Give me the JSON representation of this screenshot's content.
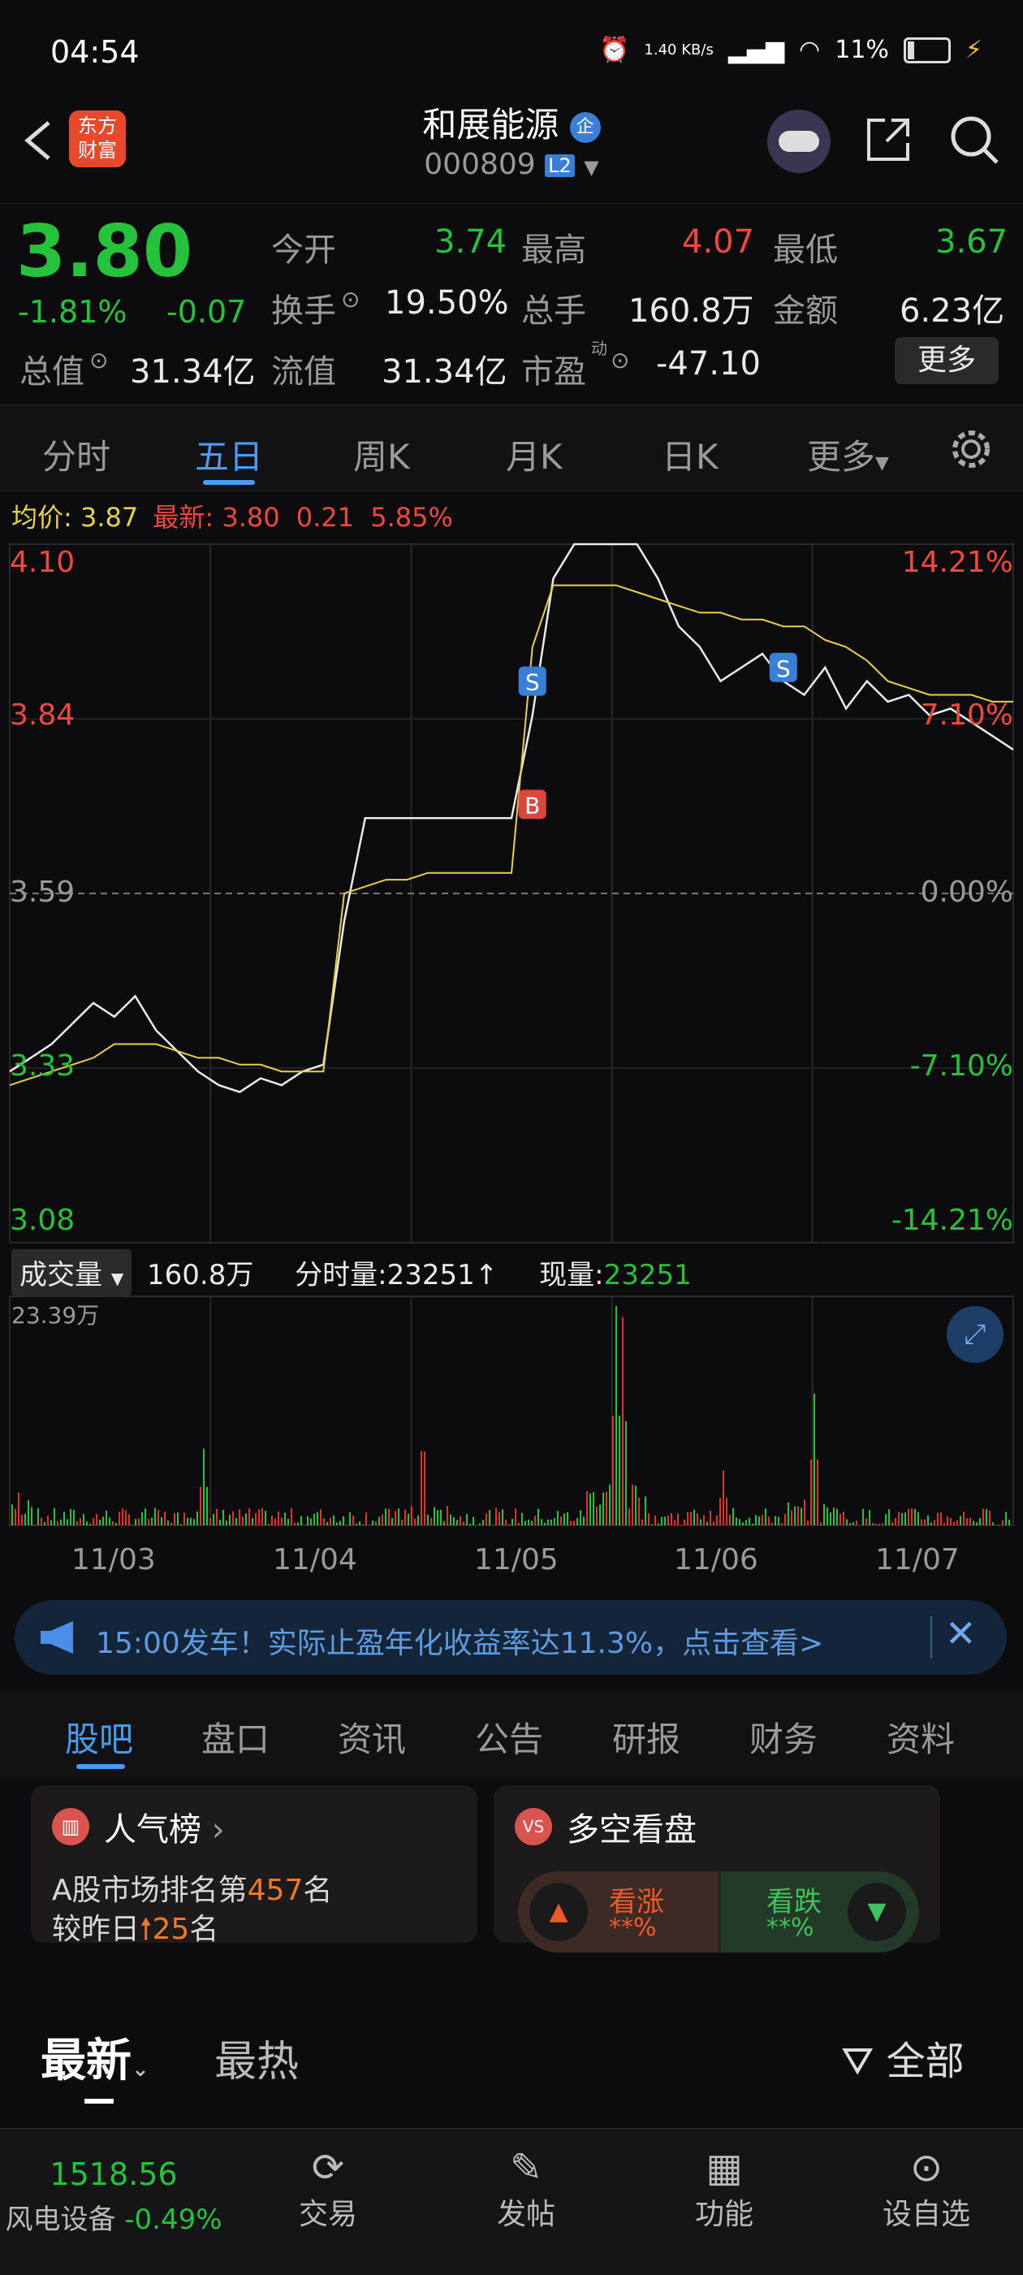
{
  "status_bar": {
    "time": "04:54",
    "net_speed": "1.40 KB/s",
    "battery": "11%"
  },
  "header": {
    "logo_line1": "东方",
    "logo_line2": "财富",
    "title": "和展能源",
    "title_badge": "企",
    "code": "000809",
    "level_badge": "L2"
  },
  "quote": {
    "price": "3.80",
    "change_pct": "-1.81%",
    "change": "-0.07",
    "open_label": "今开",
    "open": "3.74",
    "high_label": "最高",
    "high": "4.07",
    "low_label": "最低",
    "low": "3.67",
    "turnover_label": "换手",
    "turnover": "19.50%",
    "volume_label": "总手",
    "volume": "160.8万",
    "amount_label": "金额",
    "amount": "6.23亿",
    "mktcap_label": "总值",
    "mktcap": "31.34亿",
    "float_label": "流值",
    "float": "31.34亿",
    "pe_label": "市盈",
    "pe_sup": "动",
    "pe": "-47.10",
    "more_button": "更多"
  },
  "tabs": [
    "分时",
    "五日",
    "周K",
    "月K",
    "日K",
    "更多"
  ],
  "avg_line": {
    "avg_label": "均价:",
    "avg": "3.87",
    "latest_label": "最新:",
    "latest": "3.80",
    "chg": "0.21",
    "chg_pct": "5.85%"
  },
  "chart_data": {
    "type": "line",
    "title": "",
    "y_labels_left": [
      "4.10",
      "3.84",
      "3.59",
      "3.33",
      "3.08"
    ],
    "y_labels_right": [
      "14.21%",
      "7.10%",
      "0.00%",
      "-7.10%",
      "-14.21%"
    ],
    "ylim": [
      3.08,
      4.1
    ],
    "x_categories": [
      "11/03",
      "11/04",
      "11/05",
      "11/06",
      "11/07"
    ],
    "series": [
      {
        "name": "最新",
        "color": "#eaeaea",
        "values": [
          3.33,
          3.35,
          3.37,
          3.4,
          3.43,
          3.41,
          3.44,
          3.39,
          3.36,
          3.33,
          3.31,
          3.3,
          3.32,
          3.31,
          3.33,
          3.34,
          3.55,
          3.7,
          3.7,
          3.7,
          3.7,
          3.7,
          3.7,
          3.7,
          3.7,
          3.85,
          4.05,
          4.1,
          4.1,
          4.1,
          4.1,
          4.05,
          3.98,
          3.95,
          3.9,
          3.92,
          3.94,
          3.9,
          3.88,
          3.92,
          3.86,
          3.9,
          3.87,
          3.88,
          3.85,
          3.86,
          3.84,
          3.82,
          3.8
        ]
      },
      {
        "name": "均价",
        "color": "#e8d14a",
        "values": [
          3.31,
          3.32,
          3.33,
          3.34,
          3.35,
          3.37,
          3.37,
          3.37,
          3.36,
          3.35,
          3.35,
          3.34,
          3.34,
          3.33,
          3.33,
          3.33,
          3.59,
          3.6,
          3.61,
          3.61,
          3.62,
          3.62,
          3.62,
          3.62,
          3.62,
          3.95,
          4.04,
          4.04,
          4.04,
          4.04,
          4.03,
          4.02,
          4.01,
          4.0,
          4.0,
          3.99,
          3.99,
          3.98,
          3.98,
          3.96,
          3.95,
          3.93,
          3.9,
          3.89,
          3.88,
          3.88,
          3.88,
          3.87,
          3.87
        ]
      }
    ],
    "markers": [
      {
        "label": "S",
        "color": "#3a7fd6",
        "x_index": 25,
        "price": 3.9
      },
      {
        "label": "B",
        "color": "#d9473e",
        "x_index": 25,
        "price": 3.72
      },
      {
        "label": "S",
        "color": "#3a7fd6",
        "x_index": 37,
        "price": 3.92
      }
    ],
    "volume_max_label": "23.39万"
  },
  "volume_header": {
    "button": "成交量",
    "total": "160.8万",
    "tick_label": "分时量:",
    "tick": "23251",
    "now_label": "现量:",
    "now": "23251"
  },
  "banner": {
    "text": "15:00发车！实际止盈年化收益率达11.3%，点击查看>"
  },
  "content_tabs": [
    "股吧",
    "盘口",
    "资讯",
    "公告",
    "研报",
    "财务",
    "资料"
  ],
  "popularity_card": {
    "title": "人气榜",
    "line1_prefix": "A股市场排名第",
    "rank": "457",
    "line1_suffix": "名",
    "line2_prefix": "较昨日",
    "delta": "25",
    "line2_suffix": "名"
  },
  "vote_card": {
    "title": "多空看盘",
    "up_label": "看涨",
    "up_value": "**%",
    "down_label": "看跌",
    "down_value": "**%"
  },
  "feed": {
    "latest": "最新",
    "hot": "最热",
    "filter": "全部"
  },
  "bottom_bar": {
    "index_value": "1518.56",
    "index_name": "风电设备",
    "index_change": "-0.49%",
    "trade": "交易",
    "post": "发帖",
    "functions": "功能",
    "add_watch": "设自选"
  }
}
